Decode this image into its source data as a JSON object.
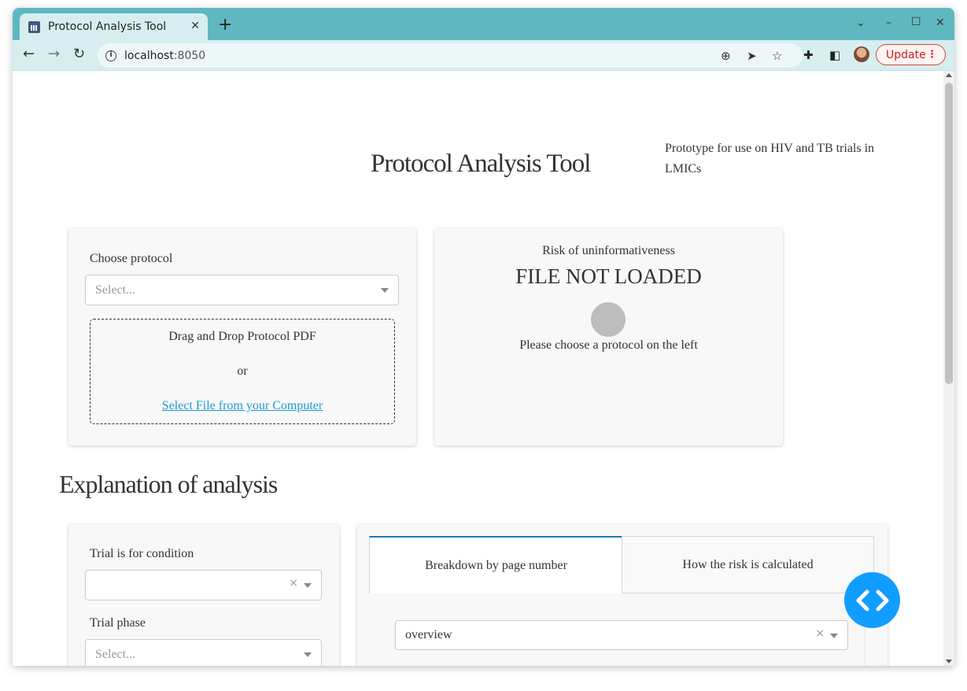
{
  "browser": {
    "tab_title": "Protocol Analysis Tool",
    "tab_close_icon": "close-icon",
    "new_tab_icon": "plus-icon",
    "url_host": "localhost",
    "url_port": ":8050",
    "update_label": "Update",
    "window_controls": [
      "chevron-down-icon",
      "minimize-icon",
      "maximize-icon",
      "close-icon"
    ]
  },
  "header": {
    "title": "Protocol Analysis Tool",
    "subtitle": "Prototype for use on HIV and TB trials in LMICs"
  },
  "protocol_card": {
    "choose_label": "Choose protocol",
    "select_placeholder": "Select...",
    "drop_text": "Drag and Drop Protocol PDF",
    "or_text": "or",
    "select_file_link": "Select File from your Computer"
  },
  "risk_card": {
    "label": "Risk of uninformativeness",
    "status": "FILE NOT LOADED",
    "indicator_color": "#bdbdbd",
    "message": "Please choose a protocol on the left"
  },
  "explanation": {
    "heading": "Explanation of analysis",
    "condition_label": "Trial is for condition",
    "condition_value": "",
    "phase_label": "Trial phase",
    "phase_placeholder": "Select...",
    "tabs": [
      {
        "label": "Breakdown by page number",
        "active": true
      },
      {
        "label": "How the risk is calculated",
        "active": false
      }
    ],
    "breakdown_select_value": "overview"
  },
  "colors": {
    "browser_frame": "#5fb8bf",
    "link": "#1f9bd6",
    "tab_accent": "#1f77b4",
    "fab": "#119dff"
  }
}
